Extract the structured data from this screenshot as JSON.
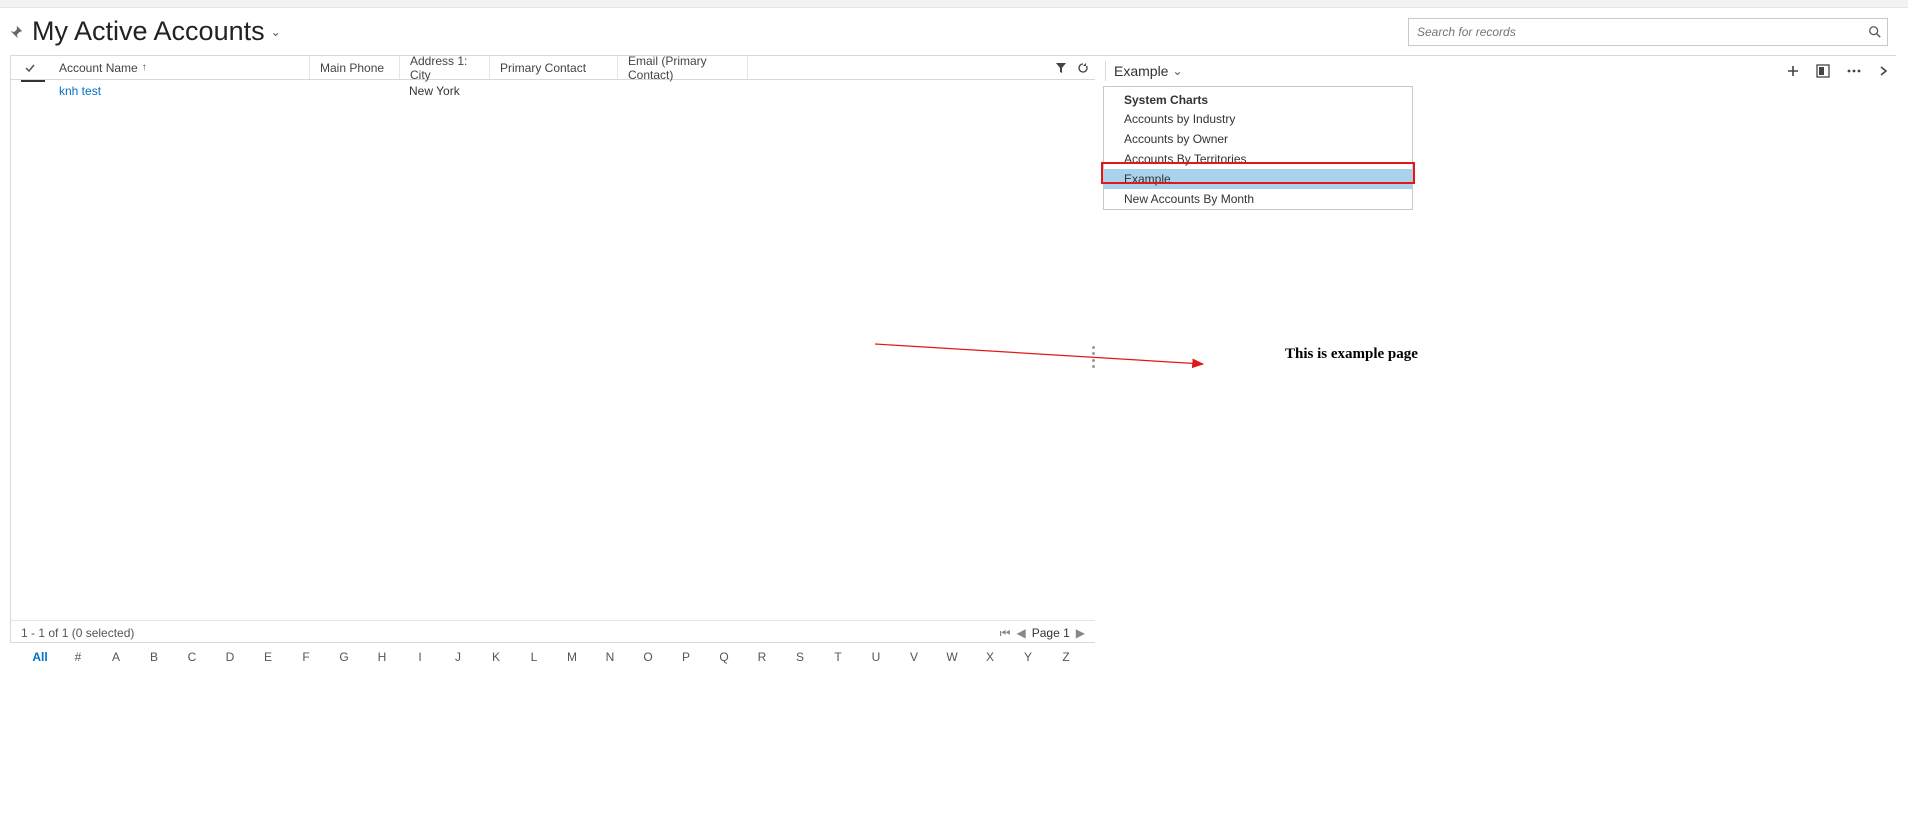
{
  "header": {
    "view_title": "My Active Accounts",
    "search_placeholder": "Search for records"
  },
  "grid": {
    "columns": {
      "name": "Account Name",
      "phone": "Main Phone",
      "city": "Address 1: City",
      "contact": "Primary Contact",
      "email": "Email (Primary Contact)"
    },
    "rows": [
      {
        "name": "knh test",
        "phone": "",
        "city": "New York",
        "contact": "",
        "email": ""
      }
    ],
    "status": "1 - 1 of 1 (0 selected)",
    "page_label": "Page 1",
    "alpha": [
      "All",
      "#",
      "A",
      "B",
      "C",
      "D",
      "E",
      "F",
      "G",
      "H",
      "I",
      "J",
      "K",
      "L",
      "M",
      "N",
      "O",
      "P",
      "Q",
      "R",
      "S",
      "T",
      "U",
      "V",
      "W",
      "X",
      "Y",
      "Z"
    ]
  },
  "chart": {
    "selected": "Example",
    "dropdown": {
      "section": "System Charts",
      "items": [
        "Accounts by Industry",
        "Accounts by Owner",
        "Accounts By Territories",
        "Example",
        "New Accounts By Month"
      ]
    },
    "body_text": "This is example page"
  }
}
